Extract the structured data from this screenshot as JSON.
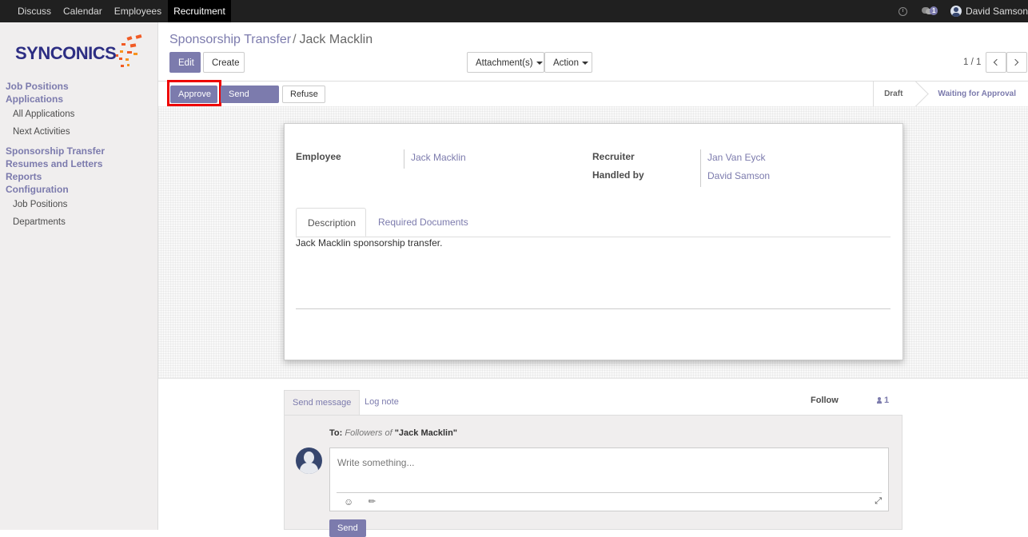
{
  "topbar": {
    "menu": [
      "Discuss",
      "Calendar",
      "Employees",
      "Recruitment"
    ],
    "active": "Recruitment",
    "notifications_count": "1",
    "user_name": "David Samson"
  },
  "sidebar": {
    "logo_text": "SYNCONICS",
    "sections": [
      {
        "title": "Job Positions",
        "items": []
      },
      {
        "title": "Applications",
        "items": [
          "All Applications",
          "Next Activities"
        ]
      },
      {
        "title": "Sponsorship Transfer",
        "items": []
      },
      {
        "title": "Resumes and Letters",
        "items": []
      },
      {
        "title": "Reports",
        "items": []
      },
      {
        "title": "Configuration",
        "items": [
          "Job Positions",
          "Departments"
        ]
      }
    ]
  },
  "control_panel": {
    "breadcrumb_parent": "Sponsorship Transfer",
    "breadcrumb_sep": "/",
    "breadcrumb_current": "Jack Macklin",
    "edit_label": "Edit",
    "create_label": "Create",
    "attachments_label": "Attachment(s)",
    "action_label": "Action",
    "pager": "1 / 1"
  },
  "header": {
    "approve_label": "Approve",
    "send_email_label": "Send Email",
    "refuse_label": "Refuse",
    "stages": [
      "Draft",
      "Waiting for Approval"
    ],
    "current_stage": "Waiting for Approval"
  },
  "form": {
    "employee_label": "Employee",
    "employee_value": "Jack Macklin",
    "recruiter_label": "Recruiter",
    "recruiter_value": "Jan Van Eyck",
    "handled_by_label": "Handled by",
    "handled_by_value": "David Samson",
    "tabs": [
      "Description",
      "Required Documents"
    ],
    "active_tab": "Description",
    "description": "Jack Macklin sponsorship transfer."
  },
  "chatter": {
    "send_message_tab": "Send message",
    "log_note_tab": "Log note",
    "follow_label": "Follow",
    "followers_count": "1",
    "to_prefix": "To:",
    "to_followers": "Followers of",
    "to_record": "\"Jack Macklin\"",
    "placeholder": "Write something...",
    "send_label": "Send"
  },
  "colors": {
    "brand": "#7c7bad",
    "highlight": "#e00000",
    "logo_blue": "#2d2e83",
    "logo_orange": "#f15a24"
  }
}
